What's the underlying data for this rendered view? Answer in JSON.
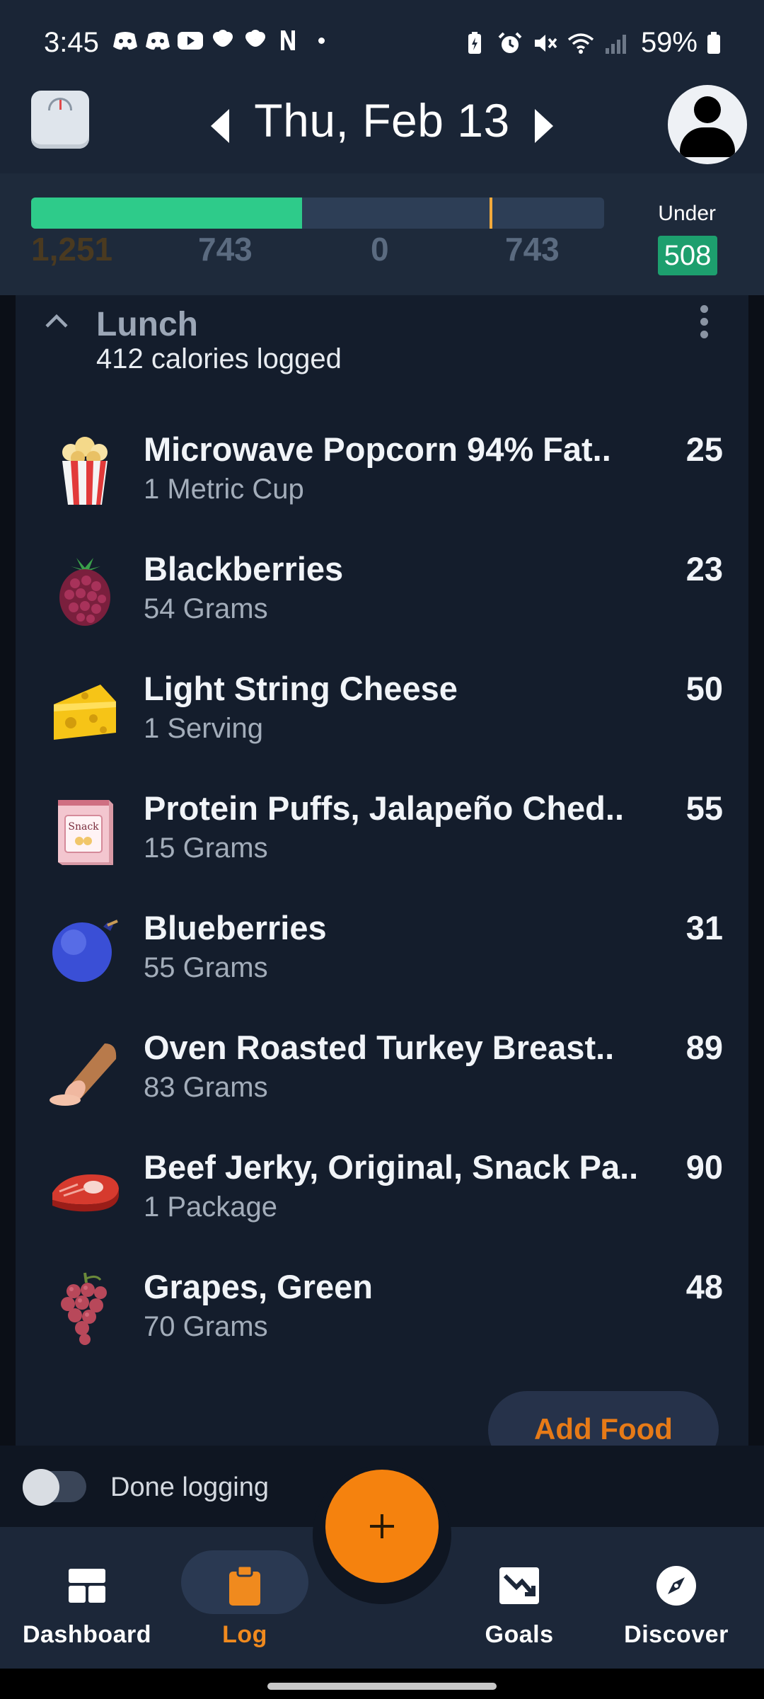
{
  "status_bar": {
    "time": "3:45",
    "battery_percent": "59%",
    "left_icons": [
      "discord-icon",
      "discord-icon",
      "youtube-icon",
      "chef-hat-icon",
      "chef-hat-icon",
      "notion-icon"
    ],
    "right_icons": [
      "battery-saver-icon",
      "alarm-icon",
      "mute-icon",
      "wifi-icon",
      "signal-icon",
      "battery-icon"
    ]
  },
  "header": {
    "date": "Thu, Feb 13",
    "left_icon": "scale-icon",
    "right_icon": "profile-icon"
  },
  "budget": {
    "eaten": "1,251",
    "value_a": "743",
    "value_b": "0",
    "value_c": "743",
    "status_label": "Under",
    "status_value": "508",
    "progress_fraction": 0.473,
    "marker_fraction": 0.8,
    "colors": {
      "fill": "#2ecb8a",
      "track": "#2d3e56",
      "marker": "#f2a93b",
      "badge": "#1d9f6e"
    }
  },
  "meal": {
    "title": "Lunch",
    "subtitle": "412 calories logged",
    "items": [
      {
        "name": "Microwave Popcorn 94% Fat..",
        "serving": "1 Metric Cup",
        "calories": "25",
        "icon": "popcorn-icon"
      },
      {
        "name": "Blackberries",
        "serving": "54 Grams",
        "calories": "23",
        "icon": "blackberry-icon"
      },
      {
        "name": "Light String Cheese",
        "serving": "1 Serving",
        "calories": "50",
        "icon": "cheese-icon"
      },
      {
        "name": "Protein Puffs, Jalapeño Ched..",
        "serving": "15 Grams",
        "calories": "55",
        "icon": "snack-bag-icon"
      },
      {
        "name": "Blueberries",
        "serving": "55 Grams",
        "calories": "31",
        "icon": "blueberry-icon"
      },
      {
        "name": "Oven Roasted Turkey Breast..",
        "serving": "83 Grams",
        "calories": "89",
        "icon": "deli-meat-icon"
      },
      {
        "name": "Beef Jerky, Original, Snack Pa..",
        "serving": "1 Package",
        "calories": "90",
        "icon": "steak-icon"
      },
      {
        "name": "Grapes, Green",
        "serving": "70 Grams",
        "calories": "48",
        "icon": "grapes-icon"
      }
    ],
    "snack_label": "Snack",
    "add_food_label": "Add Food"
  },
  "done_logging": {
    "label": "Done logging",
    "checked": false
  },
  "fab": {
    "label": "+"
  },
  "nav": {
    "items": [
      {
        "label": "Dashboard",
        "icon": "dashboard-icon",
        "active": false
      },
      {
        "label": "Log",
        "icon": "clipboard-icon",
        "active": true
      },
      {
        "label": "Goals",
        "icon": "trend-down-icon",
        "active": false
      },
      {
        "label": "Discover",
        "icon": "compass-icon",
        "active": false
      }
    ],
    "active_color": "#f08a1e"
  }
}
